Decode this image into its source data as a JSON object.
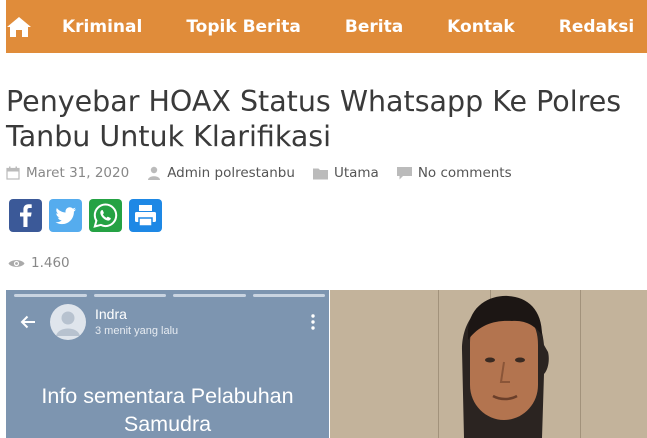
{
  "nav": {
    "items": [
      "Kriminal",
      "Topik Berita",
      "Berita",
      "Kontak",
      "Redaksi"
    ],
    "bg_color": "#e08c3a",
    "home_icon": "home-icon"
  },
  "article": {
    "title": "Penyebar HOAX Status Whatsapp Ke Polres Tanbu Untuk Klarifikasi",
    "date": "Maret 31, 2020",
    "author": "Admin polrestanbu",
    "category": "Utama",
    "comments": "No comments",
    "views": "1.460"
  },
  "share": {
    "buttons": [
      {
        "icon": "facebook-icon",
        "color": "#3b5998"
      },
      {
        "icon": "twitter-icon",
        "color": "#55acee"
      },
      {
        "icon": "whatsapp-icon",
        "color": "#25a244"
      },
      {
        "icon": "print-icon",
        "color": "#1e88e5"
      }
    ]
  },
  "image": {
    "story_user": "Indra",
    "story_time": "3 menit yang lalu",
    "story_text_line1": "Info sementara Pelabuhan",
    "story_text_line2": "Samudra"
  }
}
